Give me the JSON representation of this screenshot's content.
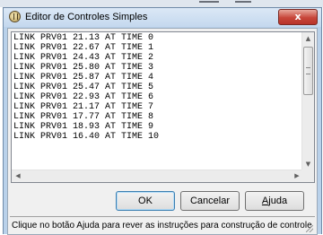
{
  "window": {
    "title": "Editor de Controles Simples",
    "close_glyph": "x"
  },
  "editor": {
    "lines": [
      "LINK PRV01 21.13 AT TIME 0",
      "LINK PRV01 22.67 AT TIME 1",
      "LINK PRV01 24.43 AT TIME 2",
      "LINK PRV01 25.80 AT TIME 3",
      "LINK PRV01 25.87 AT TIME 4",
      "LINK PRV01 25.47 AT TIME 5",
      "LINK PRV01 22.93 AT TIME 6",
      "LINK PRV01 21.17 AT TIME 7",
      "LINK PRV01 17.77 AT TIME 8",
      "LINK PRV01 18.93 AT TIME 9",
      "LINK PRV01 16.40 AT TIME 10"
    ],
    "scroll_up_glyph": "▲",
    "scroll_down_glyph": "▼",
    "scroll_left_glyph": "◀",
    "scroll_right_glyph": "▶"
  },
  "buttons": {
    "ok": "OK",
    "cancel": "Cancelar",
    "help_mnemonic": "A",
    "help_rest": "juda"
  },
  "status": {
    "text": "Clique no botão Ajuda para rever as instruções para construção de controle"
  },
  "colors": {
    "titlebar": "#c4d8ee",
    "close_button": "#c7463a",
    "client_background": "#f0f0f0",
    "default_button_border": "#3c7fb1"
  }
}
